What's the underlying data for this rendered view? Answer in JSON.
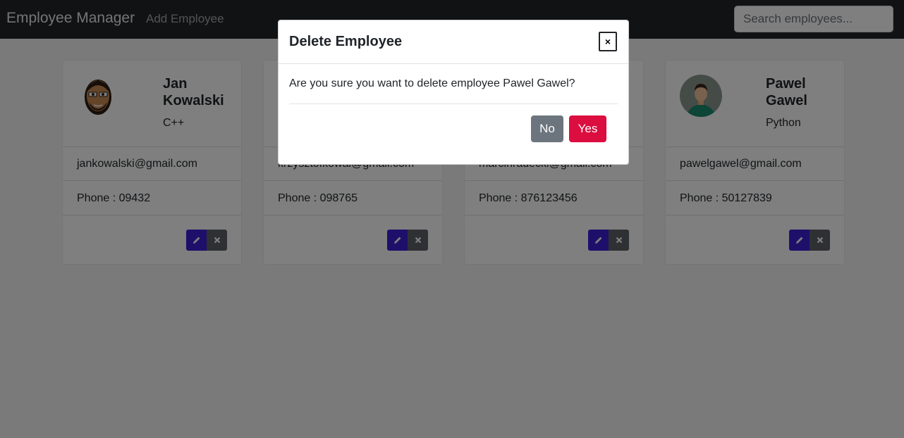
{
  "navbar": {
    "brand": "Employee Manager",
    "add_employee": "Add Employee",
    "search_placeholder": "Search employees..."
  },
  "employees": [
    {
      "name": "Jan Kowalski",
      "job": "C++",
      "email": "jankowalski@gmail.com",
      "phone": "Phone : 09432",
      "avatar_icon": "bald-bearded-man-avatar-icon"
    },
    {
      "name": "",
      "job": "",
      "email": "krzysztofkowal@gmail.com",
      "phone": "Phone : 098765",
      "avatar_icon": ""
    },
    {
      "name": "",
      "job": "",
      "email": "marcinradecki@gmail.com",
      "phone": "Phone : 876123456",
      "avatar_icon": ""
    },
    {
      "name": "Pawel Gawel",
      "job": "Python",
      "email": "pawelgawel@gmail.com",
      "phone": "Phone : 50127839",
      "avatar_icon": "man-circle-avatar-icon"
    }
  ],
  "modal": {
    "title": "Delete Employee",
    "close": "×",
    "message": "Are you sure you want to delete employee Pawel Gawel?",
    "no_label": "No",
    "yes_label": "Yes"
  },
  "colors": {
    "navbar": "#212529",
    "edit_button": "#3d1fd6",
    "delete_button": "#5c6167",
    "yes_button": "#dc0d3f",
    "no_button": "#6c757d"
  }
}
